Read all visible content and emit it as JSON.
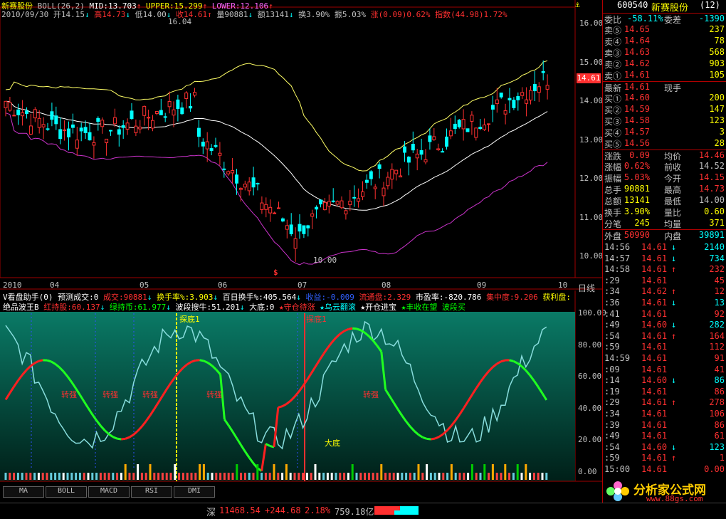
{
  "header": {
    "stock_name": "新赛股份",
    "indicator": "BOLL(26,2)",
    "mid_label": "MID:13.703",
    "upper_label": "UPPER:15.299",
    "lower_label": "LOWER:12.106",
    "date": "2010/09/30",
    "open": "开14.15",
    "high": "高14.73",
    "low": "低14.00",
    "close": "收14.61",
    "volume": "量90881",
    "amount": "额13141",
    "turnover": "换3.90%",
    "amplitude": "振5.03%",
    "change": "涨(0.09)0.62%",
    "index": "指数(44.98)1.72%"
  },
  "price_axis": [
    "16.00",
    "15.00",
    "14.00",
    "13.00",
    "12.00",
    "11.00",
    "10.00"
  ],
  "current_price_tag": "14.61",
  "annotations": {
    "peak": "16.04",
    "trough": "10.00"
  },
  "time_axis": [
    "2010",
    "04",
    "05",
    "06",
    "07",
    "08",
    "09",
    "10"
  ],
  "period_label": "日线",
  "sub_header": {
    "line1": [
      "V看盘助手(0)",
      "预测成交:0",
      "成交:90881",
      "换手率%:3.903",
      "百日换手%:405.564",
      "收益:-0.009",
      "流通盘:2.329",
      "市盈率:-820.786",
      "集中度:9.206",
      "获利盘:"
    ],
    "line2": [
      "绝品波王B",
      "红持股:60.137",
      "绿持币:61.977",
      "波段搜牛:51.201",
      "大底:0",
      "守仓待涨",
      "乌云翻滚",
      "开仓进宝",
      "丰收在望",
      "波段买"
    ]
  },
  "sub_axis": [
    "100.00",
    "80.00",
    "60.00",
    "40.00",
    "20.00",
    "0.00"
  ],
  "sub_annotations": {
    "mark1": "探底1",
    "mark2": "探底1",
    "strong": "转强",
    "bottom": "大底"
  },
  "tabs": [
    "MA",
    "BOLL",
    "MACD",
    "RSI",
    "DMI"
  ],
  "right_panel": {
    "code": "600540",
    "name": "新赛股份",
    "count": "(12)",
    "weibi_label": "委比",
    "weibi": "-58.11%",
    "weicha_label": "委差",
    "weicha": "-1390",
    "asks": [
      {
        "label": "卖⑤",
        "price": "14.65",
        "vol": "237"
      },
      {
        "label": "卖④",
        "price": "14.64",
        "vol": "78"
      },
      {
        "label": "卖③",
        "price": "14.63",
        "vol": "568"
      },
      {
        "label": "卖②",
        "price": "14.62",
        "vol": "903"
      },
      {
        "label": "卖①",
        "price": "14.61",
        "vol": "105"
      }
    ],
    "last_label": "最新",
    "last": "14.61",
    "last_note": "现手",
    "bids": [
      {
        "label": "买①",
        "price": "14.60",
        "vol": "200"
      },
      {
        "label": "买②",
        "price": "14.59",
        "vol": "147"
      },
      {
        "label": "买③",
        "price": "14.58",
        "vol": "123"
      },
      {
        "label": "买④",
        "price": "14.57",
        "vol": "3"
      },
      {
        "label": "买⑤",
        "price": "14.56",
        "vol": "28"
      }
    ],
    "stats": [
      {
        "l1": "涨跌",
        "v1": "0.09",
        "l2": "均价",
        "v2": "14.46"
      },
      {
        "l1": "涨幅",
        "v1": "0.62%",
        "l2": "前收",
        "v2": "14.52"
      },
      {
        "l1": "振幅",
        "v1": "5.03%",
        "l2": "今开",
        "v2": "14.15"
      },
      {
        "l1": "总手",
        "v1": "90881",
        "l2": "最高",
        "v2": "14.73"
      },
      {
        "l1": "总额",
        "v1": "13141",
        "l2": "最低",
        "v2": "14.00"
      },
      {
        "l1": "换手",
        "v1": "3.90%",
        "l2": "量比",
        "v2": "0.60"
      },
      {
        "l1": "分笔",
        "v1": "245",
        "l2": "均量",
        "v2": "371"
      }
    ],
    "waipan_label": "外盘",
    "waipan": "50990",
    "neipan_label": "内盘",
    "neipan": "39891",
    "ticks": [
      {
        "t": "14:56",
        "p": "14.61",
        "d": "↓",
        "v": "2140"
      },
      {
        "t": "14:57",
        "p": "14.61",
        "d": "↓",
        "v": "734"
      },
      {
        "t": "14:58",
        "p": "14.61",
        "d": "↑",
        "v": "232"
      },
      {
        "t": ":29",
        "p": "14.61",
        "d": "",
        "v": "45"
      },
      {
        "t": ":34",
        "p": "14.62",
        "d": "↑",
        "v": "12"
      },
      {
        "t": ":36",
        "p": "14.61",
        "d": "↓",
        "v": "13"
      },
      {
        "t": ":41",
        "p": "14.61",
        "d": "",
        "v": "92"
      },
      {
        "t": ":49",
        "p": "14.60",
        "d": "↓",
        "v": "282"
      },
      {
        "t": ":54",
        "p": "14.61",
        "d": "↑",
        "v": "164"
      },
      {
        "t": ":59",
        "p": "14.61",
        "d": "",
        "v": "112"
      },
      {
        "t": "14:59",
        "p": "14.61",
        "d": "",
        "v": "91"
      },
      {
        "t": ":09",
        "p": "14.61",
        "d": "",
        "v": "41"
      },
      {
        "t": ":14",
        "p": "14.60",
        "d": "↓",
        "v": "86"
      },
      {
        "t": ":19",
        "p": "14.61",
        "d": "",
        "v": "86"
      },
      {
        "t": ":29",
        "p": "14.61",
        "d": "↑",
        "v": "278"
      },
      {
        "t": ":34",
        "p": "14.61",
        "d": "",
        "v": "106"
      },
      {
        "t": ":39",
        "p": "14.61",
        "d": "",
        "v": "86"
      },
      {
        "t": ":49",
        "p": "14.61",
        "d": "",
        "v": "61"
      },
      {
        "t": ":54",
        "p": "14.60",
        "d": "↓",
        "v": "123"
      },
      {
        "t": ":59",
        "p": "14.61",
        "d": "↑",
        "v": "1"
      },
      {
        "t": "15:00",
        "p": "14.61",
        "d": "",
        "v": "0.00"
      }
    ]
  },
  "status": {
    "market": "深",
    "index": "11468.54",
    "change": "+244.68",
    "pct": "2.18%",
    "amount": "759.18亿"
  },
  "logo": {
    "text": "分析家公式网",
    "url": "www.88gs.com"
  },
  "colors": {
    "up": "#ff3030",
    "down": "#00ffff",
    "yellow": "#ffff00",
    "panel_bg": "#003a30"
  }
}
